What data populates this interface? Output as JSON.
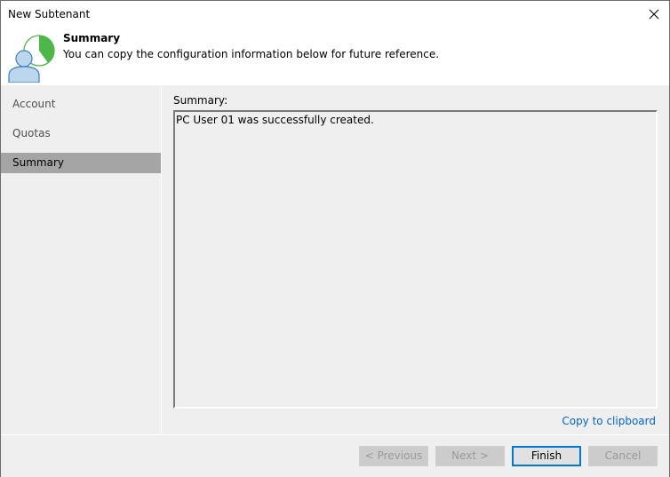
{
  "window": {
    "title": "New Subtenant",
    "close_icon": "close-icon"
  },
  "header": {
    "icon": "user-pie-progress-icon",
    "title": "Summary",
    "description": "You can copy the configuration information below for future reference."
  },
  "sidebar": {
    "items": [
      {
        "label": "Account",
        "active": false
      },
      {
        "label": "Quotas",
        "active": false
      },
      {
        "label": "Summary",
        "active": true
      }
    ]
  },
  "main": {
    "summary_label": "Summary:",
    "summary_text": "PC User 01 was successfully created.",
    "copy_link": "Copy to clipboard"
  },
  "footer": {
    "previous_label": "< Previous",
    "next_label": "Next >",
    "finish_label": "Finish",
    "cancel_label": "Cancel"
  },
  "colors": {
    "accent": "#0078d7",
    "link": "#0066cc",
    "progress_green": "#4db748",
    "selected_nav": "#a5a5a5"
  }
}
